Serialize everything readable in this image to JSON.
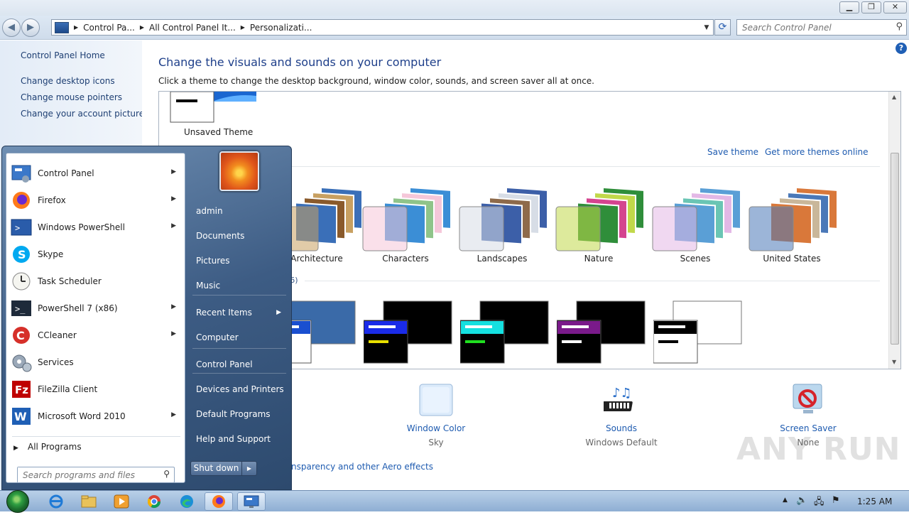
{
  "window": {
    "min_glyph": "▁",
    "max_glyph": "❐",
    "close_glyph": "✕"
  },
  "address": {
    "crumbs": [
      "Control Pa...",
      "All Control Panel It...",
      "Personalizati..."
    ],
    "search_placeholder": "Search Control Panel"
  },
  "left_pane": {
    "home": "Control Panel Home",
    "links": [
      "Change desktop icons",
      "Change mouse pointers",
      "Change your account picture"
    ]
  },
  "main": {
    "title": "Change the visuals and sounds on your computer",
    "subtitle": "Click a theme to change the desktop background, window color, sounds, and screen saver all at once.",
    "unsaved_theme": "Unsaved Theme",
    "save_theme": "Save theme",
    "get_more": "Get more themes online",
    "aero_themes": [
      {
        "name": "Architecture",
        "palette": [
          "#3a6fb8",
          "#c8a061",
          "#8a5a2b"
        ]
      },
      {
        "name": "Characters",
        "palette": [
          "#3b8ed6",
          "#f5c7d9",
          "#8fc48a"
        ]
      },
      {
        "name": "Landscapes",
        "palette": [
          "#3c5fa8",
          "#d7dde6",
          "#8e6a4a"
        ]
      },
      {
        "name": "Nature",
        "palette": [
          "#2f8e3a",
          "#c1d84a",
          "#d4448f"
        ]
      },
      {
        "name": "Scenes",
        "palette": [
          "#5a9fd6",
          "#e3b8e6",
          "#6ac5b4"
        ]
      },
      {
        "name": "United States",
        "palette": [
          "#d9783a",
          "#4a78b8",
          "#c9b79a"
        ]
      }
    ],
    "contrast_count_fragment": "(6)",
    "contrast_themes": [
      {
        "bg": "#3a6aa8",
        "bar": "#1a4fd0",
        "accent": "#ffffff"
      },
      {
        "bg": "#000000",
        "bar": "#1a2be8",
        "accent": "#e8e000"
      },
      {
        "bg": "#000000",
        "bar": "#15e0e0",
        "accent": "#20e020"
      },
      {
        "bg": "#000000",
        "bar": "#7a1a8a",
        "accent": "#ffffff"
      },
      {
        "bg": "#ffffff",
        "bar": "#000000",
        "accent": "#000000"
      }
    ],
    "tiles": {
      "window_color": {
        "name": "Window Color",
        "value": "Sky"
      },
      "sounds": {
        "name": "Sounds",
        "value": "Windows Default"
      },
      "screen_saver": {
        "name": "Screen Saver",
        "value": "None"
      }
    },
    "aero_link_fragment": "nsparency and other Aero effects",
    "watermark": "ANY RUN"
  },
  "start_menu": {
    "programs": [
      {
        "label": "Control Panel",
        "icon": "control-panel-icon",
        "arrow": true
      },
      {
        "label": "Firefox",
        "icon": "firefox-icon",
        "arrow": true
      },
      {
        "label": "Windows PowerShell",
        "icon": "powershell-icon",
        "arrow": true
      },
      {
        "label": "Skype",
        "icon": "skype-icon",
        "arrow": false
      },
      {
        "label": "Task Scheduler",
        "icon": "task-scheduler-icon",
        "arrow": false
      },
      {
        "label": "PowerShell 7 (x86)",
        "icon": "powershell7-icon",
        "arrow": true
      },
      {
        "label": "CCleaner",
        "icon": "ccleaner-icon",
        "arrow": true
      },
      {
        "label": "Services",
        "icon": "services-icon",
        "arrow": false
      },
      {
        "label": "FileZilla Client",
        "icon": "filezilla-icon",
        "arrow": false
      },
      {
        "label": "Microsoft Word 2010",
        "icon": "word-icon",
        "arrow": true
      }
    ],
    "all_programs": "All Programs",
    "search_placeholder": "Search programs and files",
    "right_links": [
      "admin",
      "Documents",
      "Pictures",
      "Music",
      "Recent Items",
      "Computer",
      "Control Panel",
      "Devices and Printers",
      "Default Programs",
      "Help and Support"
    ],
    "shutdown": "Shut down"
  },
  "taskbar": {
    "clock": "1:25 AM"
  }
}
